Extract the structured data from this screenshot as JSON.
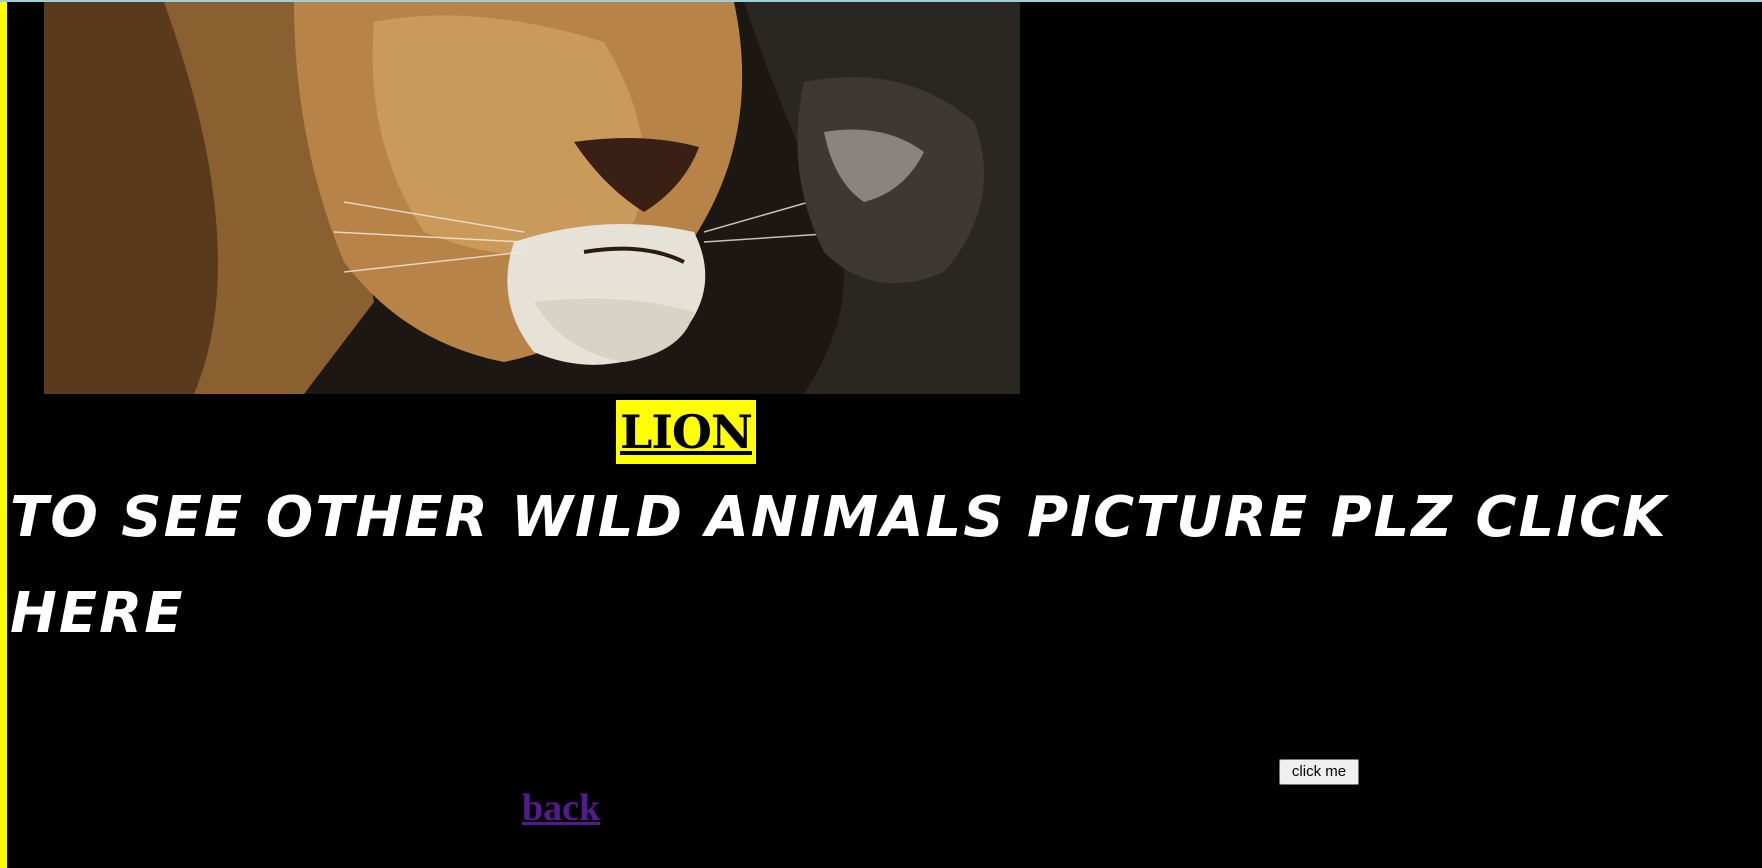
{
  "image": {
    "alt_icon": "lion-photo"
  },
  "title": "LION",
  "headline": "TO SEE OTHER WILD ANIMALS PICTURE PLZ CLICK HERE",
  "button": {
    "label": "click me"
  },
  "link": {
    "label": "back"
  },
  "colors": {
    "background": "#000000",
    "accent_yellow": "#ffff00",
    "link_visited": "#551a8b",
    "text": "#ffffff"
  }
}
